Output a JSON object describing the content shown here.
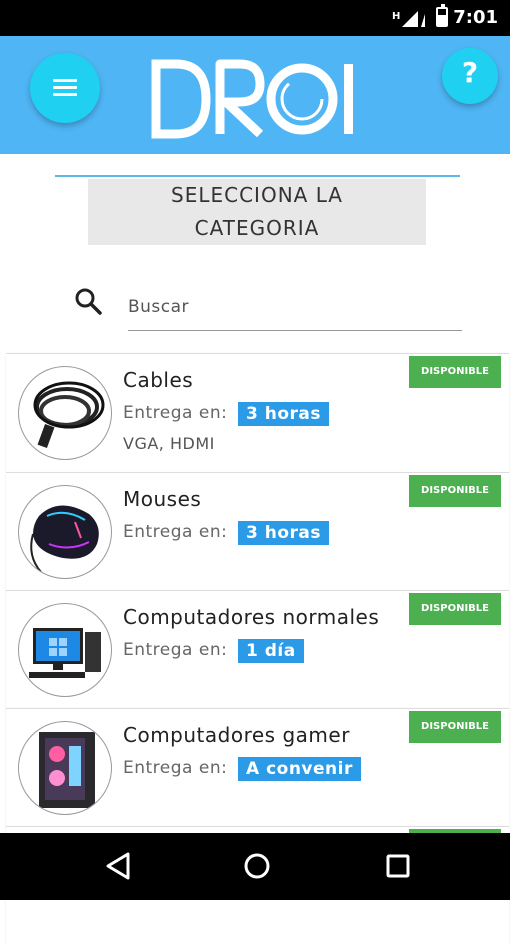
{
  "status_bar": {
    "time": "7:01"
  },
  "header": {
    "logo_text": "DROI"
  },
  "category_heading": {
    "line1": "SELECCIONA LA",
    "line2": "CATEGORIA"
  },
  "search": {
    "placeholder": "Buscar"
  },
  "items": [
    {
      "title": "Cables",
      "delivery_label": "Entrega en:",
      "delivery_value": "3 horas",
      "subtitle": "VGA, HDMI",
      "badge": "DISPONIBLE",
      "image": "cable-image"
    },
    {
      "title": "Mouses",
      "delivery_label": "Entrega en:",
      "delivery_value": "3 horas",
      "subtitle": "",
      "badge": "DISPONIBLE",
      "image": "mouse-image"
    },
    {
      "title": "Computadores normales",
      "delivery_label": "Entrega en:",
      "delivery_value": "1 día",
      "subtitle": "",
      "badge": "DISPONIBLE",
      "image": "computer-image"
    },
    {
      "title": "Computadores gamer",
      "delivery_label": "Entrega en:",
      "delivery_value": "A convenir",
      "subtitle": "",
      "badge": "DISPONIBLE",
      "image": "gaming-pc-image"
    }
  ],
  "colors": {
    "header": "#4fb5f5",
    "accent": "#1fd0f0",
    "chip": "#2b9be8",
    "badge": "#4caf50"
  }
}
